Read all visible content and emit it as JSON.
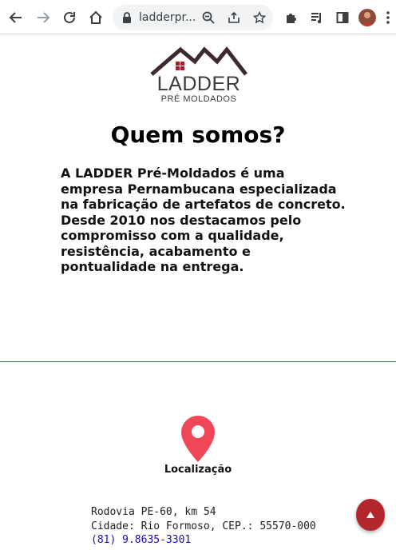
{
  "browser": {
    "url": "ladderpr...",
    "icons": {
      "back": "arrow-left-icon",
      "forward": "arrow-right-icon",
      "reload": "reload-icon",
      "home": "home-icon",
      "site_info": "lock-icon",
      "zoom": "zoom-icon",
      "share": "share-icon",
      "bookmark": "star-icon",
      "extensions": "puzzle-icon",
      "media": "media-control-icon",
      "side_panel": "side-panel-icon",
      "menu": "kebab-menu-icon"
    }
  },
  "page": {
    "logo": {
      "name": "LADDER",
      "subtitle": "PRÉ MOLDADOS"
    },
    "heading": "Quem somos?",
    "about_text": "A LADDER Pré-Moldados é uma empresa Pernambucana especializada na fabricação de artefatos de concreto. Desde 2010 nos destacamos pelo compromisso com a qualidade, resistência, acabamento e pontualidade na entrega.",
    "location": {
      "label": "Localização",
      "address_line1": "Rodovia PE-60, km 54",
      "address_line2": "Cidade: Rio Formoso, CEP.: 55570-000",
      "phone": "(81) 9.8635-3301"
    },
    "colors": {
      "pin": "#ef4658",
      "divider": "#2e7d32",
      "scroll_button": "#b3262d",
      "phone_link": "#1a0dab"
    }
  }
}
